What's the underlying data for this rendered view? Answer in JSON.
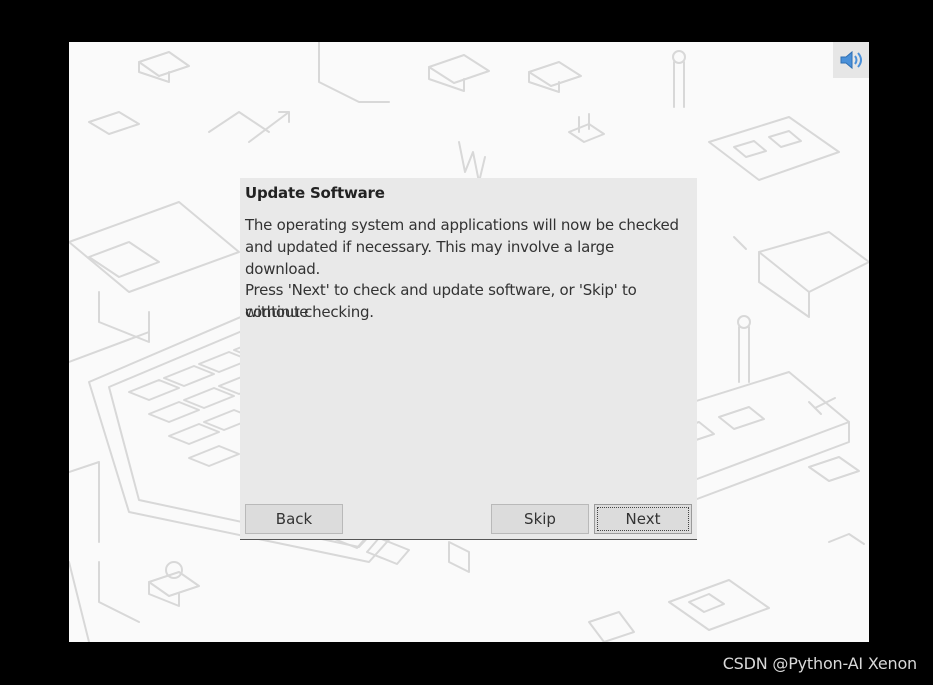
{
  "dialog": {
    "title": "Update Software",
    "paragraph1_line1": "The operating system and applications will now be checked",
    "paragraph1_line2": "and updated if necessary. This may involve a large download.",
    "paragraph2_line1": "Press 'Next' to check and update software, or 'Skip' to continue",
    "paragraph2_line2": "without checking.",
    "back_label": "Back",
    "skip_label": "Skip",
    "next_label": "Next"
  },
  "tray": {
    "icon": "volume-icon",
    "accent": "#4a90d9"
  },
  "watermark": "CSDN @Python-AI Xenon"
}
